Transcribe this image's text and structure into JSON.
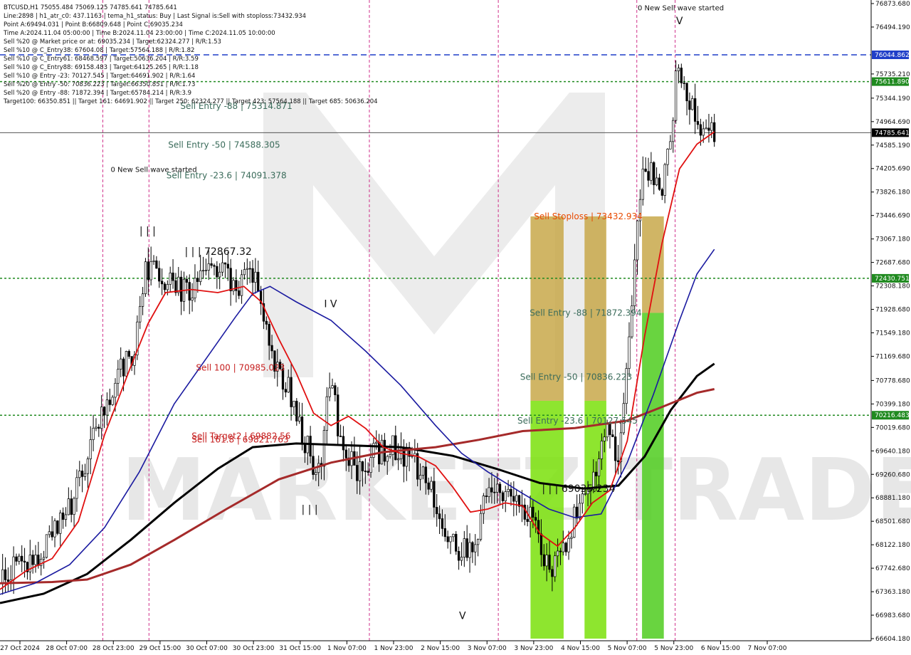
{
  "info_lines": [
    "BTCUSD,H1  75055.484 75069.125 74785.641 74785.641",
    "Line:2898  | h1_atr_c0: 437.1163  | tema_h1_status: Buy  | Last Signal is:Sell with stoploss:73432.934",
    "Point A:69494.031  | Point B:66809.648  | Point C:69035.234",
    "Time A:2024.11.04 05:00:00  | Time B:2024.11.04 23:00:00  | Time C:2024.11.05 10:00:00",
    "Sell %20 @ Market price or at: 69035.234  | Target:62324.277  | R/R:1.53",
    "Sell %10 @ C_Entry38: 67604.08  | Target:57564.188  | R/R:1.82",
    "Sell %10 @ C_Entry61: 68468.597  | Target:50636.204  | R/R:3.59",
    "Sell %10 @ C_Entry88: 69158.483  | Target:64125.265  | R/R:1.18",
    "Sell %10 @ Entry -23: 70127.545  | Target:64691.902  | R/R:1.64",
    "Sell %20 @ Entry -50: 70836.223  | Target:66350.851  | R/R:1.73",
    "Sell %20 @ Entry -88: 71872.394  | Target:65784.214  | R/R:3.9",
    "Target100: 66350.851  || Target 161: 64691.902  || Target 250: 62324.277  || Target 423: 57564.188  || Target 685: 50636.204"
  ],
  "chart_data": {
    "type": "candlestick",
    "symbol": "BTCUSD",
    "timeframe": "H1",
    "ylim": [
      66604.18,
      76873.68
    ],
    "y_ticks": [
      "76873.680",
      "76494.190",
      "75735.210",
      "75344.190",
      "74964.690",
      "74585.190",
      "74205.690",
      "73826.180",
      "73446.690",
      "73067.180",
      "72687.680",
      "72308.180",
      "71928.680",
      "71549.180",
      "71169.680",
      "70778.680",
      "70399.180",
      "70019.680",
      "69640.180",
      "69260.680",
      "68881.180",
      "68501.680",
      "68122.180",
      "67742.680",
      "67363.180",
      "66983.680",
      "66604.180"
    ],
    "x_ticks": [
      "27 Oct 2024",
      "28 Oct 07:00",
      "28 Oct 23:00",
      "29 Oct 15:00",
      "30 Oct 07:00",
      "30 Oct 23:00",
      "31 Oct 15:00",
      "1 Nov 07:00",
      "1 Nov 23:00",
      "2 Nov 15:00",
      "3 Nov 07:00",
      "3 Nov 23:00",
      "4 Nov 15:00",
      "5 Nov 07:00",
      "5 Nov 23:00",
      "6 Nov 15:00",
      "7 Nov 07:00"
    ],
    "price_tags": [
      {
        "text": "76044.862",
        "value": 76044.862,
        "color": "#1f3ec8"
      },
      {
        "text": "75611.890",
        "value": 75611.89,
        "color": "#1f8a1f"
      },
      {
        "text": "74785.641",
        "value": 74785.641,
        "color": "#000000"
      },
      {
        "text": "72430.751",
        "value": 72430.751,
        "color": "#1f8a1f"
      },
      {
        "text": "70216.483",
        "value": 70216.483,
        "color": "#1f8a1f"
      }
    ],
    "hlines": [
      {
        "value": 76044.862,
        "color": "#1f3ec8",
        "style": "dash"
      },
      {
        "value": 75611.89,
        "color": "#1f8a1f",
        "style": "dot"
      },
      {
        "value": 74785.641,
        "color": "#555555",
        "style": "solid"
      },
      {
        "value": 72430.751,
        "color": "#1f8a1f",
        "style": "dot"
      },
      {
        "value": 70216.483,
        "color": "#1f8a1f",
        "style": "dot"
      }
    ],
    "level_labels": [
      {
        "text": "Sell Entry -88 | 75314.871",
        "value": 75214,
        "xfrac": 0.207,
        "color": "#3a6b5a"
      },
      {
        "text": "Sell Entry -50 | 74588.305",
        "value": 74588,
        "xfrac": 0.193,
        "color": "#3a6b5a"
      },
      {
        "text": "Sell Entry -23.6 | 74091.378",
        "value": 74091,
        "xfrac": 0.191,
        "color": "#3a6b5a"
      },
      {
        "text": "Sell 100 | 70985.023",
        "value": 70985,
        "xfrac": 0.225,
        "color": "#c62020"
      },
      {
        "text": "Sell Target2 | 69882.56",
        "value": 69882,
        "xfrac": 0.22,
        "color": "#c62020"
      },
      {
        "text": "Sell 161.8 | 69821.763",
        "value": 69821,
        "xfrac": 0.22,
        "color": "#c62020"
      },
      {
        "text": "Sell Stoploss | 73432.934",
        "value": 73432,
        "xfrac": 0.613,
        "color": "#e84a00"
      },
      {
        "text": "Sell Entry -88 | 71872.394",
        "value": 71872,
        "xfrac": 0.608,
        "color": "#3a6b5a"
      },
      {
        "text": "Sell Entry -50 | 70836.223",
        "value": 70836,
        "xfrac": 0.597,
        "color": "#3a6b5a"
      },
      {
        "text": "Sell Entry -23.6 | 70127.545",
        "value": 70127,
        "xfrac": 0.594,
        "color": "#3a6b5a"
      }
    ],
    "wave_labels": [
      {
        "text": "| | | 72867.32",
        "value": 72868,
        "xfrac": 0.212
      },
      {
        "text": "| | | 69035.234",
        "value": 69035,
        "xfrac": 0.622
      },
      {
        "text": "0 New Sell wave started",
        "value": 74210,
        "xfrac": 0.127
      },
      {
        "text": "0 New Sell wave started",
        "value": 76820,
        "xfrac": 0.732
      }
    ],
    "points": [
      {
        "text": "| | |",
        "value": 73200,
        "xfrac": 0.16
      },
      {
        "text": "I V",
        "value": 72020,
        "xfrac": 0.372
      },
      {
        "text": "| | |",
        "value": 68700,
        "xfrac": 0.346
      },
      {
        "text": "V",
        "value": 66980,
        "xfrac": 0.527
      },
      {
        "text": "V",
        "value": 76600,
        "xfrac": 0.776
      }
    ],
    "vlines_xfrac": [
      0.118,
      0.171,
      0.424,
      0.572,
      0.731,
      0.775
    ],
    "zones": [
      {
        "x0": 0.609,
        "x1": 0.647,
        "y_top": 73432,
        "y_bot": 70450,
        "color": "#c8a84a"
      },
      {
        "x0": 0.609,
        "x1": 0.647,
        "y_top": 70450,
        "y_bot": 66604,
        "color": "#7ae10a"
      },
      {
        "x0": 0.671,
        "x1": 0.696,
        "y_top": 73432,
        "y_bot": 70450,
        "color": "#c8a84a"
      },
      {
        "x0": 0.671,
        "x1": 0.696,
        "y_top": 70450,
        "y_bot": 66604,
        "color": "#7ae10a"
      },
      {
        "x0": 0.737,
        "x1": 0.762,
        "y_top": 73432,
        "y_bot": 71872,
        "color": "#c8a84a"
      },
      {
        "x0": 0.737,
        "x1": 0.762,
        "y_top": 71872,
        "y_bot": 66604,
        "color": "#4fcc1e"
      }
    ],
    "series": [
      {
        "kind": "ma",
        "color": "#000000",
        "width": 3,
        "points": [
          [
            0,
            67180
          ],
          [
            0.05,
            67330
          ],
          [
            0.1,
            67650
          ],
          [
            0.15,
            68200
          ],
          [
            0.2,
            68800
          ],
          [
            0.25,
            69350
          ],
          [
            0.29,
            69700
          ],
          [
            0.34,
            69760
          ],
          [
            0.4,
            69730
          ],
          [
            0.46,
            69700
          ],
          [
            0.52,
            69560
          ],
          [
            0.57,
            69350
          ],
          [
            0.62,
            69120
          ],
          [
            0.67,
            69030
          ],
          [
            0.71,
            69080
          ],
          [
            0.74,
            69550
          ],
          [
            0.77,
            70300
          ],
          [
            0.8,
            70850
          ],
          [
            0.82,
            71050
          ]
        ]
      },
      {
        "kind": "ma",
        "color": "#a52a2a",
        "width": 3,
        "points": [
          [
            0,
            67500
          ],
          [
            0.06,
            67520
          ],
          [
            0.1,
            67560
          ],
          [
            0.15,
            67800
          ],
          [
            0.2,
            68200
          ],
          [
            0.26,
            68700
          ],
          [
            0.32,
            69180
          ],
          [
            0.38,
            69450
          ],
          [
            0.44,
            69620
          ],
          [
            0.5,
            69700
          ],
          [
            0.55,
            69820
          ],
          [
            0.6,
            69960
          ],
          [
            0.66,
            70010
          ],
          [
            0.72,
            70130
          ],
          [
            0.76,
            70350
          ],
          [
            0.8,
            70580
          ],
          [
            0.82,
            70640
          ]
        ]
      },
      {
        "kind": "ma",
        "color": "#1a1aa0",
        "width": 1.6,
        "points": [
          [
            0,
            67320
          ],
          [
            0.04,
            67500
          ],
          [
            0.08,
            67800
          ],
          [
            0.12,
            68400
          ],
          [
            0.16,
            69300
          ],
          [
            0.2,
            70400
          ],
          [
            0.24,
            71200
          ],
          [
            0.27,
            71800
          ],
          [
            0.29,
            72180
          ],
          [
            0.31,
            72300
          ],
          [
            0.34,
            72050
          ],
          [
            0.38,
            71750
          ],
          [
            0.42,
            71250
          ],
          [
            0.46,
            70700
          ],
          [
            0.5,
            70050
          ],
          [
            0.53,
            69600
          ],
          [
            0.56,
            69300
          ],
          [
            0.6,
            68950
          ],
          [
            0.63,
            68700
          ],
          [
            0.66,
            68560
          ],
          [
            0.69,
            68620
          ],
          [
            0.72,
            69450
          ],
          [
            0.75,
            70550
          ],
          [
            0.78,
            71750
          ],
          [
            0.8,
            72500
          ],
          [
            0.82,
            72900
          ]
        ]
      },
      {
        "kind": "ma",
        "color": "#e01010",
        "width": 1.8,
        "points": [
          [
            0,
            67400
          ],
          [
            0.03,
            67700
          ],
          [
            0.06,
            67900
          ],
          [
            0.09,
            68500
          ],
          [
            0.12,
            69900
          ],
          [
            0.15,
            71000
          ],
          [
            0.17,
            71700
          ],
          [
            0.19,
            72200
          ],
          [
            0.22,
            72250
          ],
          [
            0.25,
            72200
          ],
          [
            0.28,
            72300
          ],
          [
            0.3,
            72050
          ],
          [
            0.32,
            71450
          ],
          [
            0.34,
            70900
          ],
          [
            0.36,
            70250
          ],
          [
            0.38,
            70050
          ],
          [
            0.4,
            70200
          ],
          [
            0.42,
            70000
          ],
          [
            0.44,
            69700
          ],
          [
            0.46,
            69600
          ],
          [
            0.48,
            69550
          ],
          [
            0.5,
            69400
          ],
          [
            0.52,
            69050
          ],
          [
            0.54,
            68650
          ],
          [
            0.56,
            68700
          ],
          [
            0.58,
            68800
          ],
          [
            0.6,
            68750
          ],
          [
            0.62,
            68300
          ],
          [
            0.64,
            68100
          ],
          [
            0.66,
            68400
          ],
          [
            0.68,
            68800
          ],
          [
            0.7,
            69000
          ],
          [
            0.72,
            69800
          ],
          [
            0.74,
            71500
          ],
          [
            0.76,
            73000
          ],
          [
            0.78,
            74200
          ],
          [
            0.8,
            74600
          ],
          [
            0.82,
            74800
          ]
        ]
      }
    ],
    "candles_seed": 20241107,
    "candle_anchors": [
      [
        0,
        67500
      ],
      [
        0.02,
        67900
      ],
      [
        0.04,
        67800
      ],
      [
        0.06,
        68400
      ],
      [
        0.08,
        68700
      ],
      [
        0.1,
        69500
      ],
      [
        0.12,
        70400
      ],
      [
        0.14,
        71000
      ],
      [
        0.155,
        71200
      ],
      [
        0.165,
        72500
      ],
      [
        0.175,
        72700
      ],
      [
        0.19,
        72400
      ],
      [
        0.21,
        72200
      ],
      [
        0.23,
        72400
      ],
      [
        0.25,
        72600
      ],
      [
        0.27,
        72300
      ],
      [
        0.29,
        72500
      ],
      [
        0.3,
        72200
      ],
      [
        0.31,
        71200
      ],
      [
        0.33,
        70700
      ],
      [
        0.35,
        69800
      ],
      [
        0.36,
        69400
      ],
      [
        0.37,
        69600
      ],
      [
        0.38,
        71100
      ],
      [
        0.39,
        69700
      ],
      [
        0.41,
        69300
      ],
      [
        0.43,
        69600
      ],
      [
        0.45,
        69700
      ],
      [
        0.47,
        69500
      ],
      [
        0.49,
        69200
      ],
      [
        0.51,
        68400
      ],
      [
        0.53,
        68000
      ],
      [
        0.55,
        68300
      ],
      [
        0.56,
        69200
      ],
      [
        0.58,
        69000
      ],
      [
        0.6,
        68800
      ],
      [
        0.62,
        68200
      ],
      [
        0.63,
        67700
      ],
      [
        0.645,
        67950
      ],
      [
        0.66,
        68600
      ],
      [
        0.68,
        69100
      ],
      [
        0.69,
        69700
      ],
      [
        0.7,
        70100
      ],
      [
        0.71,
        69400
      ],
      [
        0.72,
        71000
      ],
      [
        0.73,
        73200
      ],
      [
        0.74,
        74300
      ],
      [
        0.75,
        74100
      ],
      [
        0.76,
        73900
      ],
      [
        0.77,
        74600
      ],
      [
        0.775,
        75600
      ],
      [
        0.78,
        75900
      ],
      [
        0.79,
        75400
      ],
      [
        0.8,
        75000
      ],
      [
        0.81,
        74800
      ],
      [
        0.82,
        74790
      ]
    ]
  }
}
